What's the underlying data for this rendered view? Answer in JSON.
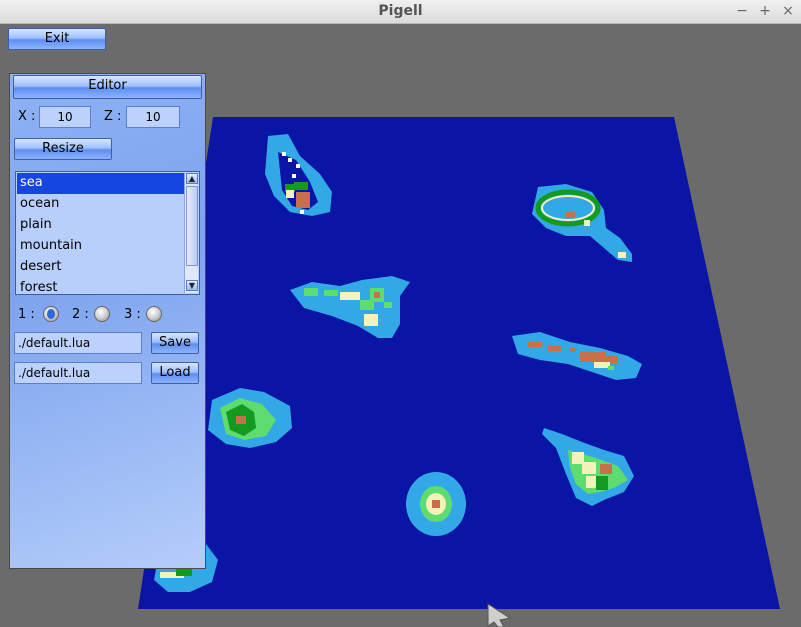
{
  "window": {
    "title": "Pigell",
    "minimize_glyph": "−",
    "maximize_glyph": "+",
    "close_glyph": "×"
  },
  "toolbar": {
    "exit_label": "Exit"
  },
  "editor": {
    "title": "Editor",
    "x_label": "X :",
    "x_value": "10",
    "z_label": "Z :",
    "z_value": "10",
    "resize_label": "Resize",
    "terrain_list": [
      "sea",
      "ocean",
      "plain",
      "mountain",
      "desert",
      "forest"
    ],
    "selected_terrain": "sea",
    "layer_radios": [
      {
        "label": "1 :",
        "selected": true
      },
      {
        "label": "2 :",
        "selected": false
      },
      {
        "label": "3 :",
        "selected": false
      }
    ],
    "save_path": "./default.lua",
    "save_label": "Save",
    "load_path": "./default.lua",
    "load_label": "Load"
  },
  "map": {
    "colors": {
      "background": "#6b6b6b",
      "sea": "#0a14a5",
      "ocean": "#33a8e6",
      "plain": "#5fdc6f",
      "forest": "#139a1f",
      "desert": "#f2f2ba",
      "mountain": "#c8704a",
      "peak": "#ffffff"
    }
  }
}
